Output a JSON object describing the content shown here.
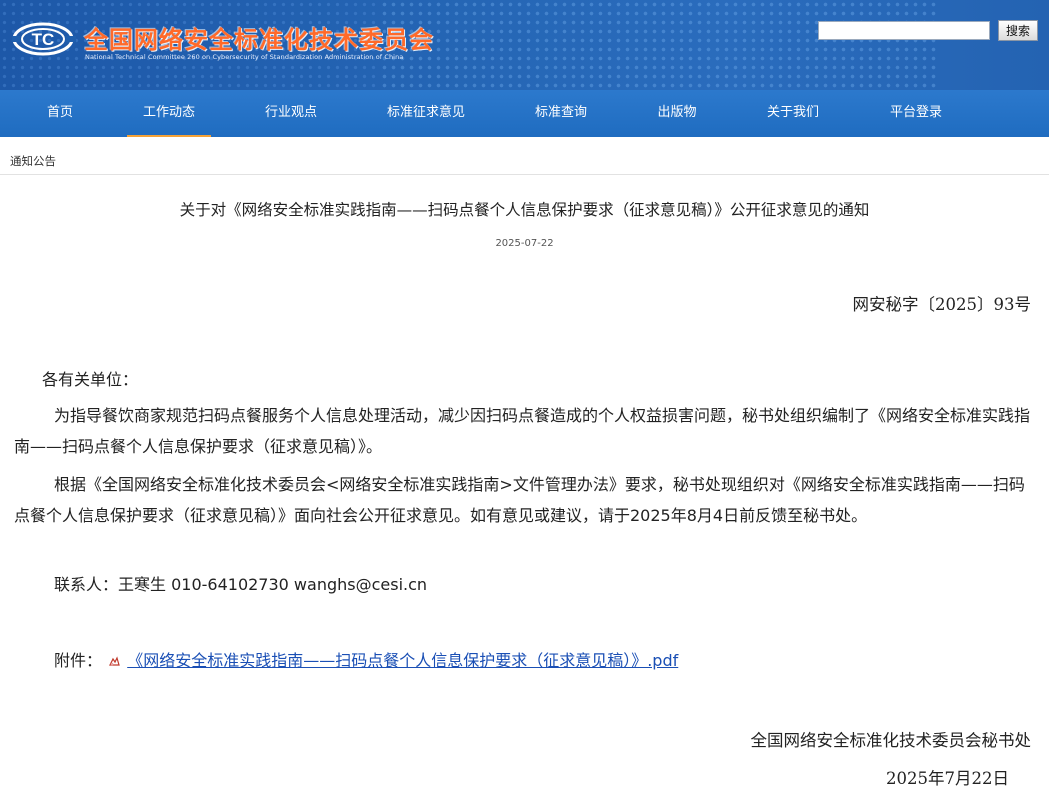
{
  "header": {
    "title": "全国网络安全标准化技术委员会",
    "subtitle": "National Technical Committee 260 on Cybersecurity of Standardization Administration of China",
    "logo_text": "TC",
    "search": {
      "placeholder": "",
      "value": "",
      "button_label": "搜索"
    }
  },
  "nav": {
    "items": [
      {
        "label": "首页"
      },
      {
        "label": "工作动态",
        "active": true
      },
      {
        "label": "行业观点"
      },
      {
        "label": "标准征求意见"
      },
      {
        "label": "标准查询"
      },
      {
        "label": "出版物"
      },
      {
        "label": "关于我们"
      },
      {
        "label": "平台登录"
      }
    ]
  },
  "breadcrumb": "通知公告",
  "article": {
    "title": "关于对《网络安全标准实践指南——扫码点餐个人信息保护要求（征求意见稿）》公开征求意见的通知",
    "date": "2025-07-22",
    "doc_number": "网安秘字〔2025〕93号",
    "salutation": "各有关单位：",
    "para1": "为指导餐饮商家规范扫码点餐服务个人信息处理活动，减少因扫码点餐造成的个人权益损害问题，秘书处组织编制了《网络安全标准实践指南——扫码点餐个人信息保护要求（征求意见稿）》。",
    "para2": "根据《全国网络安全标准化技术委员会<网络安全标准实践指南>文件管理办法》要求，秘书处现组织对《网络安全标准实践指南——扫码点餐个人信息保护要求（征求意见稿）》面向社会公开征求意见。如有意见或建议，请于2025年8月4日前反馈至秘书处。",
    "contact": "联系人：王寒生 010-64102730  wanghs@cesi.cn",
    "attachment_label": "附件：",
    "attachment_link": "《网络安全标准实践指南——扫码点餐个人信息保护要求（征求意见稿）》.pdf",
    "signature": "全国网络安全标准化技术委员会秘书处",
    "sign_date": "2025年7月22日"
  },
  "colors": {
    "header_blue": "#2566b5",
    "nav_blue": "#1f6cc0",
    "title_orange": "#ff6a2a",
    "active_underline": "#f4a237",
    "link_blue": "#1a4fb5"
  },
  "icons": {
    "attachment": "pdf-file-icon",
    "logo": "tc-emblem-icon"
  }
}
